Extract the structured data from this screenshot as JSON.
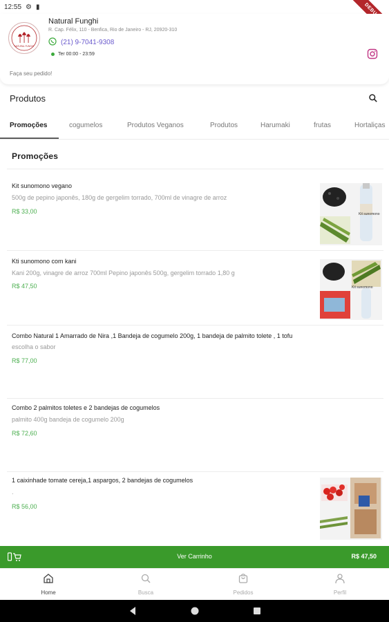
{
  "status_bar": {
    "time": "12:55"
  },
  "debug_banner": "DEBUG",
  "store": {
    "name": "Natural Funghi",
    "address": "R. Cap. Félix, 110 - Benfica, Rio de Janeiro - RJ, 20920-310",
    "phone": "(21) 9-7041-9308",
    "hours": "Ter 00:00 - 23:59",
    "order_hint": "Faça seu pedido!",
    "logo_text": "NATURAL FUNGHI"
  },
  "products_header": {
    "title": "Produtos"
  },
  "tabs": [
    {
      "label": "Promoções",
      "active": true
    },
    {
      "label": "cogumelos",
      "active": false
    },
    {
      "label": "Produtos Veganos",
      "active": false
    },
    {
      "label": "Produtos",
      "active": false
    },
    {
      "label": "Harumaki",
      "active": false
    },
    {
      "label": "frutas",
      "active": false
    },
    {
      "label": "Hortaliças",
      "active": false
    }
  ],
  "section": {
    "title": "Promoções"
  },
  "products": [
    {
      "name": "Kit sunomono vegano",
      "description": "500g de pepino japonês, 180g de gergelim torrado, 700ml de vinagre de arroz",
      "price": "R$ 33,00",
      "image": "kit-sunomono-vegano-photo"
    },
    {
      "name": "Kti sunomono com kani",
      "description": "Kani 200g, vinagre de arroz 700ml Pepino japonês 500g, gergelim torrado 1,80 g",
      "price": "R$ 47,50",
      "image": "kit-sunomono-kani-photo"
    },
    {
      "name": "Combo Natural 1 Amarrado de Nira ,1 Bandeja de cogumelo 200g, 1 bandeja de palmito tolete , 1 tofu",
      "description": "escolha o sabor",
      "price": "R$ 77,00",
      "image": null
    },
    {
      "name": "Combo 2 palmitos toletes e 2 bandejas de cogumelos",
      "description": "palmito 400g bandeja de cogumelo 200g",
      "price": "R$ 72,60",
      "image": null
    },
    {
      "name": "1 caixinhade tomate cereja,1 aspargos, 2 bandejas de cogumelos",
      "description": ".",
      "price": "R$ 56,00",
      "image": "tomate-aspargos-cogumelos-photo"
    }
  ],
  "cart": {
    "label": "Ver Carrinho",
    "total": "R$ 47,50"
  },
  "bottom_nav": [
    {
      "label": "Home",
      "icon": "home-icon",
      "active": true
    },
    {
      "label": "Busca",
      "icon": "search-icon",
      "active": false
    },
    {
      "label": "Pedidos",
      "icon": "bag-icon",
      "active": false
    },
    {
      "label": "Perfil",
      "icon": "person-icon",
      "active": false
    }
  ],
  "colors": {
    "brand_green": "#3a9a2b",
    "price_green": "#4caf50",
    "phone_purple": "#6a5acd",
    "instagram": "#c13584",
    "debug_red": "#b3262b"
  }
}
